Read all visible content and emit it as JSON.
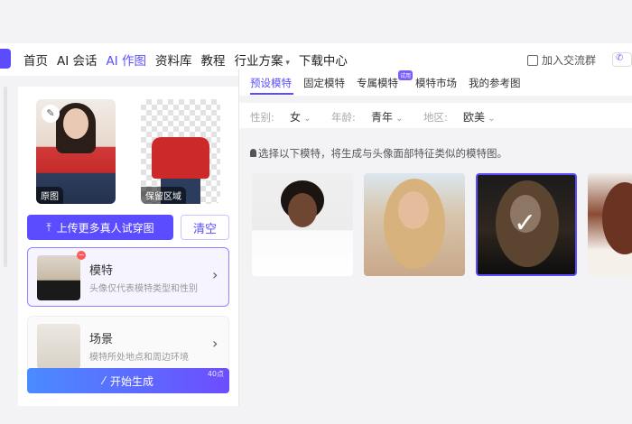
{
  "nav": {
    "items": [
      "首页",
      "AI 会话",
      "AI 作图",
      "资料库",
      "教程",
      "行业方案",
      "下载中心"
    ],
    "active_index": 2,
    "join_label": "加入交流群"
  },
  "left": {
    "original_tag": "原图",
    "keep_tag": "保留区域",
    "upload_label": "上传更多真人试穿图",
    "clear_label": "清空",
    "model_card": {
      "title": "模特",
      "subtitle": "头像仅代表模特类型和性别"
    },
    "scene_card": {
      "title": "场景",
      "subtitle": "模特所处地点和周边环境"
    },
    "generate_label": "开始生成",
    "generate_cost": "40点"
  },
  "right": {
    "tabs": [
      "预设模特",
      "固定模特",
      "专属模特",
      "模特市场",
      "我的参考图"
    ],
    "active_tab": 0,
    "tab_badge": "试用",
    "filters": {
      "gender_label": "性别:",
      "gender_value": "女",
      "age_label": "年龄:",
      "age_value": "青年",
      "region_label": "地区:",
      "region_value": "欧美"
    },
    "hint": "选择以下模特，将生成与头像面部特征类似的模特图。",
    "models": [
      "model-afro",
      "model-blonde",
      "model-selected",
      "model-brunette"
    ],
    "selected_model_index": 2
  },
  "colors": {
    "accent": "#5b4dff",
    "generate_gradient_start": "#4a8cff",
    "generate_gradient_end": "#6d4dff"
  }
}
